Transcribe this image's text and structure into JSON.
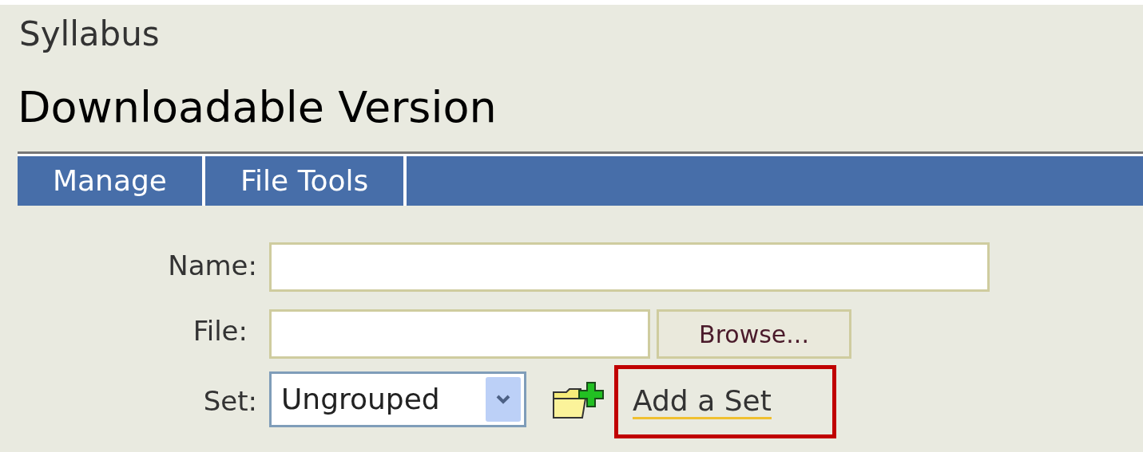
{
  "page_title": "Syllabus",
  "heading": "Downloadable Version",
  "tabs": [
    {
      "label": "Manage"
    },
    {
      "label": "File Tools"
    }
  ],
  "form": {
    "name_label": "Name:",
    "file_label": "File:",
    "browse_button": "Browse...",
    "set_label": "Set:",
    "set_value": "Ungrouped"
  },
  "add_set_link": {
    "label": "Add a Set",
    "highlighted": true
  }
}
